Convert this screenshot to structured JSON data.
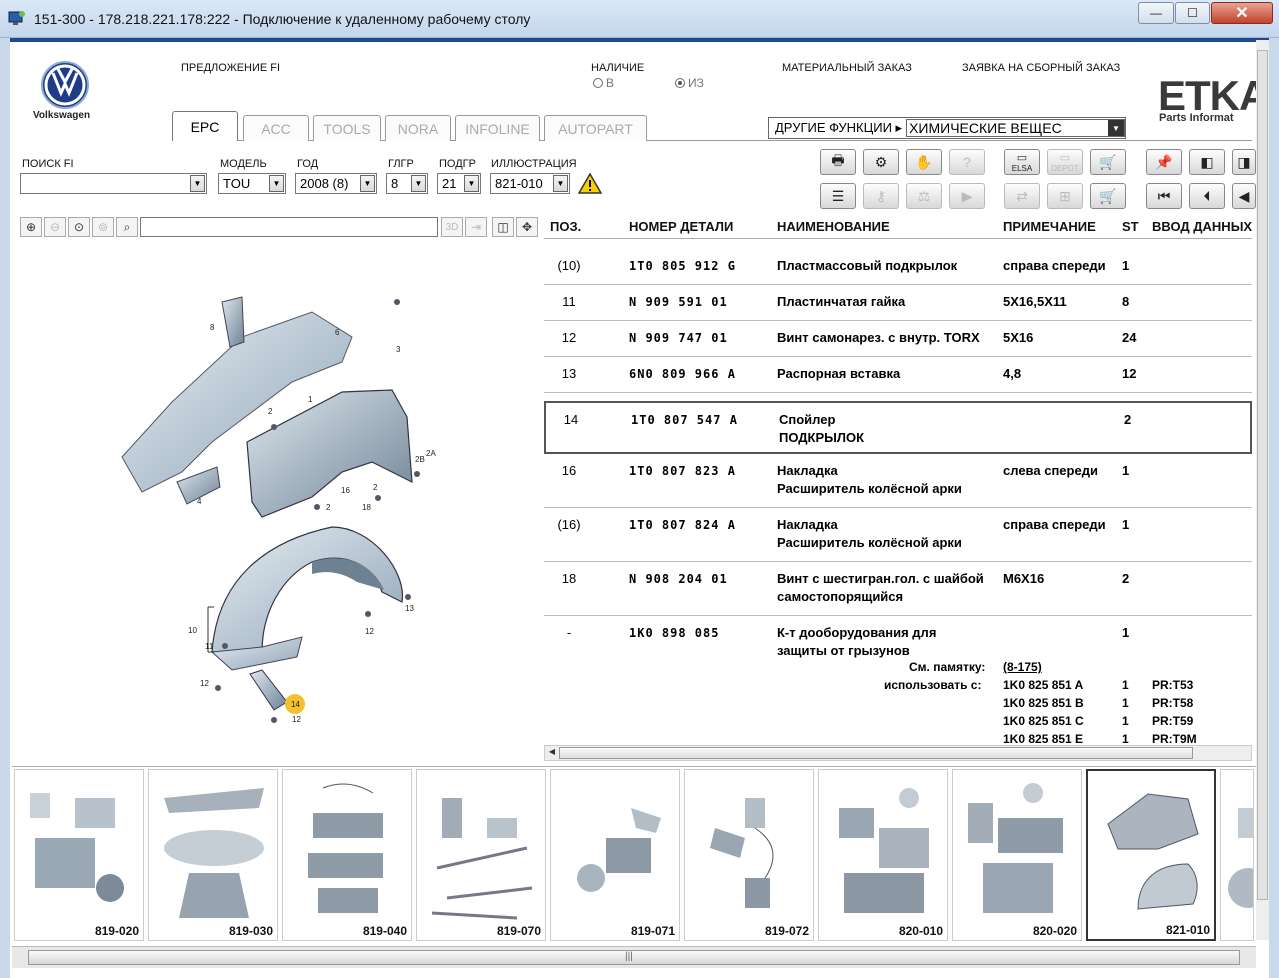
{
  "window": {
    "title": "151-300 - 178.218.221.178:222 - Подключение к удаленному рабочему столу",
    "min_glyph": "—",
    "max_glyph": "☐",
    "close_glyph": "✕"
  },
  "header": {
    "brand": "Volkswagen",
    "offer_fi": "ПРЕДЛОЖЕНИЕ FI",
    "availability": "НАЛИЧИЕ",
    "avail_in": "В",
    "avail_from": "ИЗ",
    "material_order": "МАТЕРИАЛЬНЫЙ ЗАКАЗ",
    "assembly_order": "ЗАЯВКА НА СБОРНЫЙ ЗАКАЗ",
    "etka_logo": "ETKA",
    "etka_sub": "Parts Informat"
  },
  "tabs": [
    "EPC",
    "ACC",
    "TOOLS",
    "NORA",
    "INFOLINE",
    "AUTOPART"
  ],
  "other_functions": {
    "label": "ДРУГИЕ ФУНКЦИИ ▸",
    "value": "ХИМИЧЕСКИЕ ВЕЩЕС"
  },
  "filters": {
    "search_label": "ПОИСК FI",
    "search_value": "",
    "model_label": "МОДЕЛЬ",
    "model_value": "TOU",
    "year_label": "ГОД",
    "year_value": "2008 (8)",
    "group_label": "ГЛГР",
    "group_value": "8",
    "subgroup_label": "ПОДГР",
    "subgroup_value": "21",
    "illustration_label": "ИЛЛЮСТРАЦИЯ",
    "illustration_value": "821-010"
  },
  "toolbar_labels": {
    "elsa": "ELSA",
    "depot": "DEPOT",
    "zoom3d": "3D"
  },
  "table": {
    "headers": {
      "pos": "ПОЗ.",
      "part": "НОМЕР ДЕТАЛИ",
      "name": "НАИМЕНОВАНИЕ",
      "note": "ПРИМЕЧАНИЕ",
      "st": "ST",
      "input": "ВВОД ДАННЫХ"
    },
    "rows": [
      {
        "pos": "(10)",
        "part": "1T0  805  912  G",
        "name": "Пластмассовый подкрылок",
        "name2": "",
        "note": "справа спереди",
        "st": "1"
      },
      {
        "pos": "11",
        "part": "N    909  591  01",
        "name": "Пластинчатая гайка",
        "name2": "",
        "note": "5X16,5X11",
        "st": "8"
      },
      {
        "pos": "12",
        "part": "N    909  747  01",
        "name": "Винт самонарез. с внутр. TORX",
        "name2": "",
        "note": "5X16",
        "st": "24"
      },
      {
        "pos": "13",
        "part": "6N0  809  966  A",
        "name": "Распорная вставка",
        "name2": "",
        "note": "4,8",
        "st": "12"
      },
      {
        "pos": "14",
        "part": "1T0  807  547  A",
        "name": "Спойлер",
        "name2": "ПОДКРЫЛОК",
        "note": "",
        "st": "2"
      },
      {
        "pos": "16",
        "part": "1T0  807  823  A",
        "name": "Накладка",
        "name2": "Расширитель колёсной арки",
        "note": "слева спереди",
        "st": "1"
      },
      {
        "pos": "(16)",
        "part": "1T0  807  824  A",
        "name": "Накладка",
        "name2": "Расширитель колёсной арки",
        "note": "справа спереди",
        "st": "1"
      },
      {
        "pos": "18",
        "part": "N    908  204  01",
        "name": "Винт с шестигран.гол. с шайбой",
        "name2": "самостопорящийся",
        "note": "M6X16",
        "st": "2"
      },
      {
        "pos": "-",
        "part": "1K0  898  085",
        "name": "К-т дооборудования для",
        "name2": "защиты от грызунов",
        "note": "",
        "st": "1"
      }
    ],
    "see_memo_label": "См. памятку:",
    "see_memo_value": "(8-175)",
    "use_with_label": "использовать с:",
    "use_with": [
      {
        "part": "1K0 825 851 A",
        "qty": "1",
        "pr": "PR:T53"
      },
      {
        "part": "1K0 825 851 B",
        "qty": "1",
        "pr": "PR:T58"
      },
      {
        "part": "1K0 825 851 C",
        "qty": "1",
        "pr": "PR:T59"
      },
      {
        "part": "1K0 825 851 E",
        "qty": "1",
        "pr": "PR:T9M"
      }
    ]
  },
  "illustration_callouts": [
    "8",
    "6",
    "3",
    "1",
    "2",
    "2B",
    "2A",
    "16",
    "2",
    "18",
    "2",
    "4",
    "13",
    "10",
    "11",
    "12",
    "12",
    "14",
    "12"
  ],
  "thumbnails": [
    "819-020",
    "819-030",
    "819-040",
    "819-070",
    "819-071",
    "819-072",
    "820-010",
    "820-020",
    "821-010"
  ],
  "colors": {
    "frame_blue": "#1d4b8f",
    "highlight_yellow": "#f2c12e",
    "selected_border": "#555555"
  }
}
